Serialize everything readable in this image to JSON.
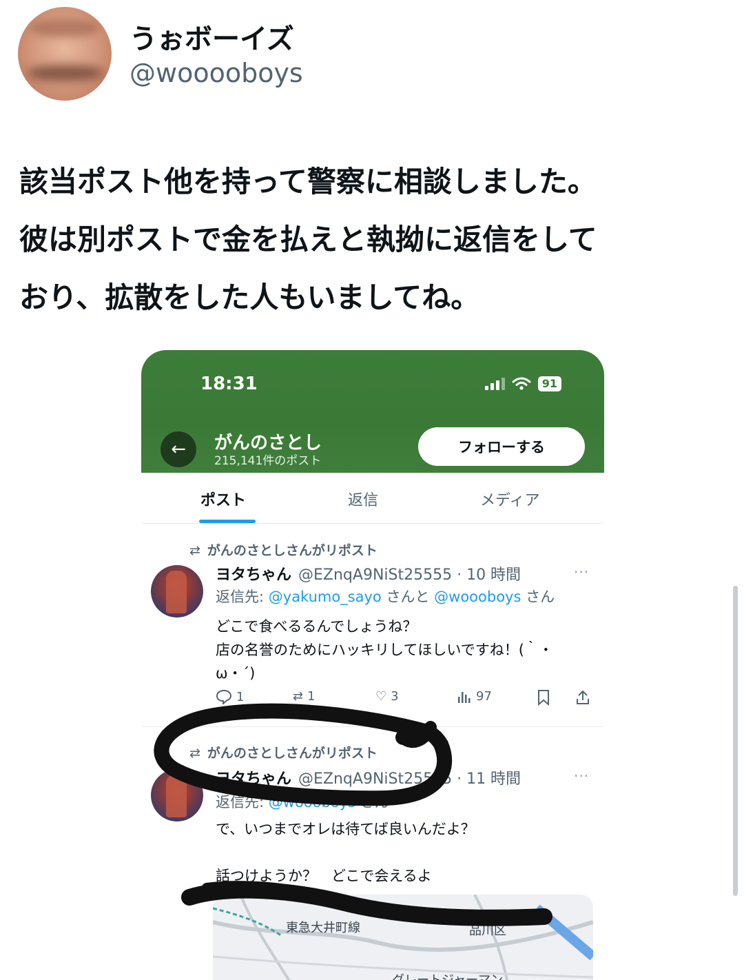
{
  "post": {
    "author_name": "うぉボーイズ",
    "author_handle": "@wooooboys",
    "body": "該当ポスト他を持って警察に相談しました。\n彼は別ポストで金を払えと執拗に返信をして\nおり、拡散をした人もいましてね。"
  },
  "screenshot": {
    "status_time": "18:31",
    "battery": "91",
    "profile_name": "がんのさとし",
    "profile_post_count": "215,141件のポスト",
    "follow_label": "フォローする",
    "back_icon": "←",
    "tabs": [
      {
        "label": "ポスト",
        "active": true
      },
      {
        "label": "返信",
        "active": false
      },
      {
        "label": "メディア",
        "active": false
      }
    ],
    "tweets": [
      {
        "repost_label": "がんのさとしさんがリポスト",
        "name": "ヨタちゃん",
        "meta": "@EZnqA9NiSt25555 · 10 時間",
        "more": "···",
        "reply_prefix": "返信先: ",
        "reply_link1": "@yakumo_sayo",
        "reply_mid": " さんと ",
        "reply_link2": "@woooboys",
        "reply_suffix": " さん",
        "body": "どこで食べるるんでしょうね？\n店の名誉のためにハッキリしてほしいですね！(｀・\nω・´)",
        "replies": "1",
        "reposts": "1",
        "likes": "3",
        "views": "97"
      },
      {
        "repost_label": "がんのさとしさんがリポスト",
        "name": "ヨタちゃん",
        "meta": "@EZnqA9NiSt25555 · 11 時間",
        "more": "···",
        "reply_prefix": "返信先: ",
        "reply_link1": "@woooboys",
        "reply_suffix": " さん",
        "body": "で、いつまでオレは待てば良いんだよ？\n\n話つけようか？　どこで会えるよ"
      }
    ],
    "map_labels": [
      "東急大井町線",
      "品川区",
      "グレートジャーマン"
    ]
  }
}
